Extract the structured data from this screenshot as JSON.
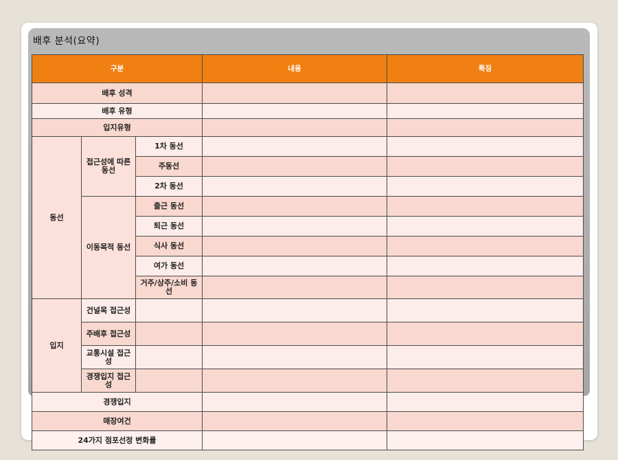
{
  "title": "배후 분석(요약)",
  "header": {
    "col1": "구분",
    "col2": "내용",
    "col3": "특징"
  },
  "rows": {
    "r1": "배후 성격",
    "r2": "배후 유형",
    "r3": "입지유형",
    "group_dongseon": "동선",
    "sub_access": "접근성에 따른 동선",
    "a1": "1차 동선",
    "a2": "주동선",
    "a3": "2차 동선",
    "sub_purpose": "이동목적 동선",
    "p1": "출근 동선",
    "p2": "퇴근 동선",
    "p3": "식사 동선",
    "p4": "여가 동선",
    "p5": "거주/상주/소비 동선",
    "group_ipji": "입지",
    "i1": "건널목 접근성",
    "i2": "주배후 접근성",
    "i3": "교통시설 접근성",
    "i4": "경쟁입지 접근성",
    "r4": "경쟁입지",
    "r5": "매장여건",
    "r6": "24가지 점포선정 변화률"
  }
}
